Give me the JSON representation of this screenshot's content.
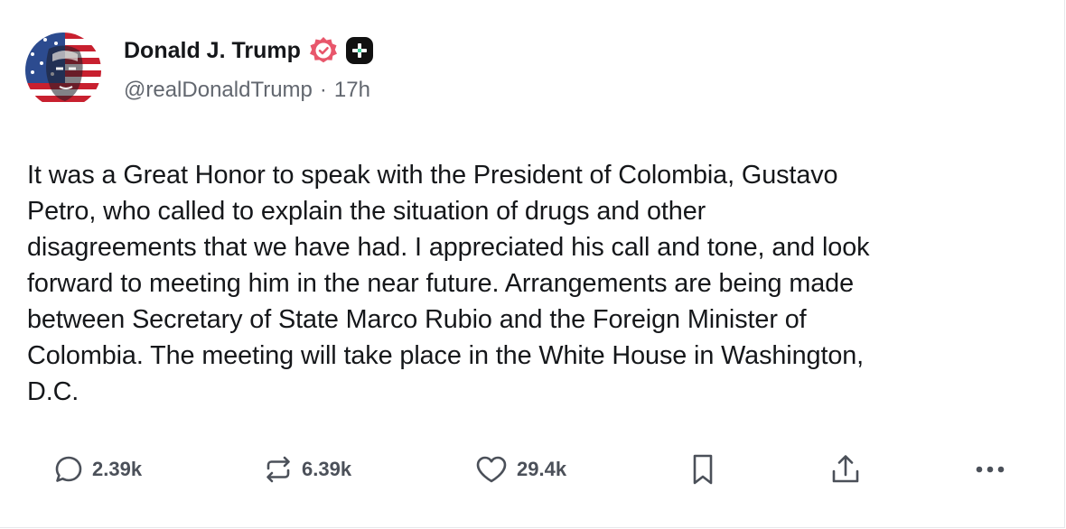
{
  "author": {
    "display_name": "Donald J. Trump",
    "handle": "@realDonaldTrump",
    "separator": "·",
    "time_ago": "17h",
    "verified_color": "#e8566b"
  },
  "post": {
    "lines": [
      "It was a Great Honor to speak with the President of Colombia, Gustavo",
      "Petro, who called to explain the situation of drugs and other",
      "disagreements that we have had. I appreciated his call and tone, and look",
      "forward to meeting him in the near future. Arrangements are being made",
      "between Secretary of State Marco Rubio and the Foreign Minister of",
      "Colombia. The meeting will take place in the White House in Washington,",
      "D.C."
    ]
  },
  "actions": {
    "reply_count": "2.39k",
    "repost_count": "6.39k",
    "like_count": "29.4k",
    "icons": [
      "reply-icon",
      "repost-icon",
      "heart-icon",
      "bookmark-icon",
      "share-icon",
      "more-icon"
    ]
  }
}
